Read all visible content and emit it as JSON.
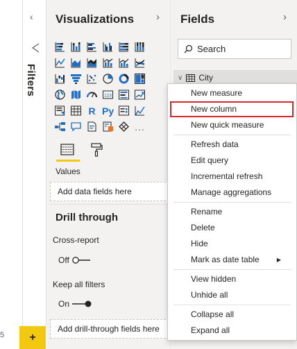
{
  "canvas": {
    "page_number": "5",
    "add_page_label": "+"
  },
  "filters": {
    "title": "Filters",
    "collapse_glyph": "‹",
    "funnel_glyph": "◁"
  },
  "visualizations": {
    "title": "Visualizations",
    "expand_glyph": "›",
    "icons": [
      "stacked-bar-chart-icon",
      "stacked-column-chart-icon",
      "clustered-bar-chart-icon",
      "clustered-column-chart-icon",
      "100-percent-bar-chart-icon",
      "100-percent-column-chart-icon",
      "",
      "line-chart-icon",
      "area-chart-icon",
      "stacked-area-chart-icon",
      "line-clustered-column-icon",
      "line-stacked-column-icon",
      "ribbon-chart-icon",
      "",
      "waterfall-chart-icon",
      "funnel-chart-icon",
      "scatter-chart-icon",
      "pie-chart-icon",
      "donut-chart-icon",
      "treemap-icon",
      "",
      "map-icon",
      "filled-map-icon",
      "gauge-icon",
      "card-icon",
      "multi-row-card-icon",
      "kpi-icon",
      "",
      "slicer-icon",
      "table-icon",
      "matrix-icon",
      "r-visual-icon",
      "python-visual-icon",
      "key-influencers-icon",
      "",
      "decomposition-tree-icon",
      "qa-icon",
      "smart-narrative-icon",
      "paginated-report-icon",
      "arcgis-map-icon",
      "more-icon",
      ""
    ],
    "r_label": "R",
    "py_label": "Py",
    "more_label": "...",
    "values_label": "Values",
    "values_placeholder": "Add data fields here",
    "drill_title": "Drill through",
    "cross_report_label": "Cross-report",
    "cross_report_state": "Off",
    "keep_filters_label": "Keep all filters",
    "keep_filters_state": "On",
    "drill_placeholder": "Add drill-through fields here"
  },
  "fields": {
    "title": "Fields",
    "expand_glyph": "›",
    "search_placeholder": "Search",
    "table_name": "City",
    "expand_chevron": "∨"
  },
  "context_menu": {
    "highlighted": "New column",
    "groups": [
      [
        "New measure",
        "New column",
        "New quick measure"
      ],
      [
        "Refresh data",
        "Edit query",
        "Incremental refresh",
        "Manage aggregations"
      ],
      [
        "Rename",
        "Delete",
        "Hide",
        "Mark as date table"
      ],
      [
        "View hidden",
        "Unhide all"
      ],
      [
        "Collapse all",
        "Expand all"
      ]
    ],
    "submenu_item": "Mark as date table",
    "submenu_glyph": "▶"
  },
  "colors": {
    "accent": "#f2c811",
    "highlight_border": "#d9262b",
    "pane_bg": "#f3f2f1",
    "icon_blue": "#1f6fc5"
  }
}
